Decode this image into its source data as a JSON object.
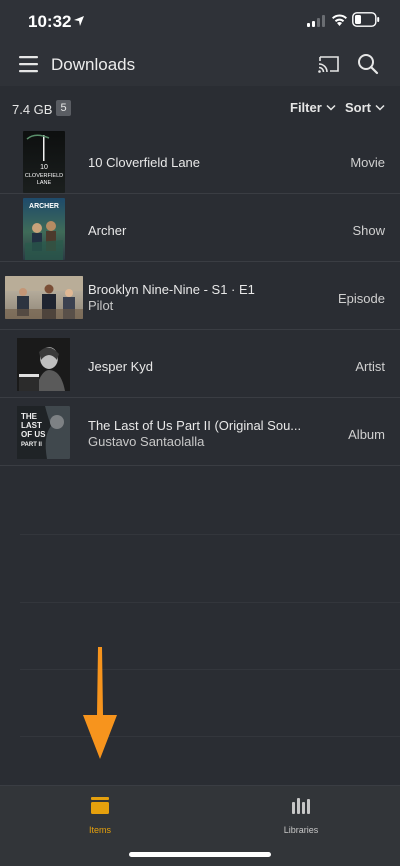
{
  "status_bar": {
    "time": "10:32",
    "location_icon": "location-arrow-icon",
    "signal_icon": "cellular-signal-icon",
    "wifi_icon": "wifi-icon",
    "battery_icon": "battery-low-icon"
  },
  "header": {
    "title": "Downloads",
    "menu_icon": "hamburger-menu-icon",
    "cast_icon": "cast-icon",
    "search_icon": "search-icon"
  },
  "summary": {
    "size": "7.4 GB",
    "count": "5",
    "filter_label": "Filter",
    "sort_label": "Sort"
  },
  "items": [
    {
      "title": "10 Cloverfield Lane",
      "subtitle": "",
      "type": "Movie",
      "poster_text": [
        "10",
        "CLOVERFIELD",
        "LANE"
      ]
    },
    {
      "title": "Archer",
      "subtitle": "",
      "type": "Show",
      "poster_text": [
        "ARCHER"
      ]
    },
    {
      "title": "Brooklyn Nine-Nine - S1 · E1",
      "subtitle": "Pilot",
      "type": "Episode",
      "poster_text": []
    },
    {
      "title": "Jesper Kyd",
      "subtitle": "",
      "type": "Artist",
      "poster_text": []
    },
    {
      "title": "The Last of Us Part II (Original Sou...",
      "subtitle": "Gustavo Santaolalla",
      "type": "Album",
      "poster_text": [
        "THE",
        "LAST",
        "OF US",
        "PART II"
      ]
    }
  ],
  "tabs": [
    {
      "label": "Items",
      "icon": "stack-icon",
      "active": true
    },
    {
      "label": "Libraries",
      "icon": "library-bars-icon",
      "active": false
    }
  ],
  "colors": {
    "accent": "#e5a00d",
    "background": "#2a2d33",
    "header": "#2f3238",
    "annotation_arrow": "#f7941d"
  }
}
